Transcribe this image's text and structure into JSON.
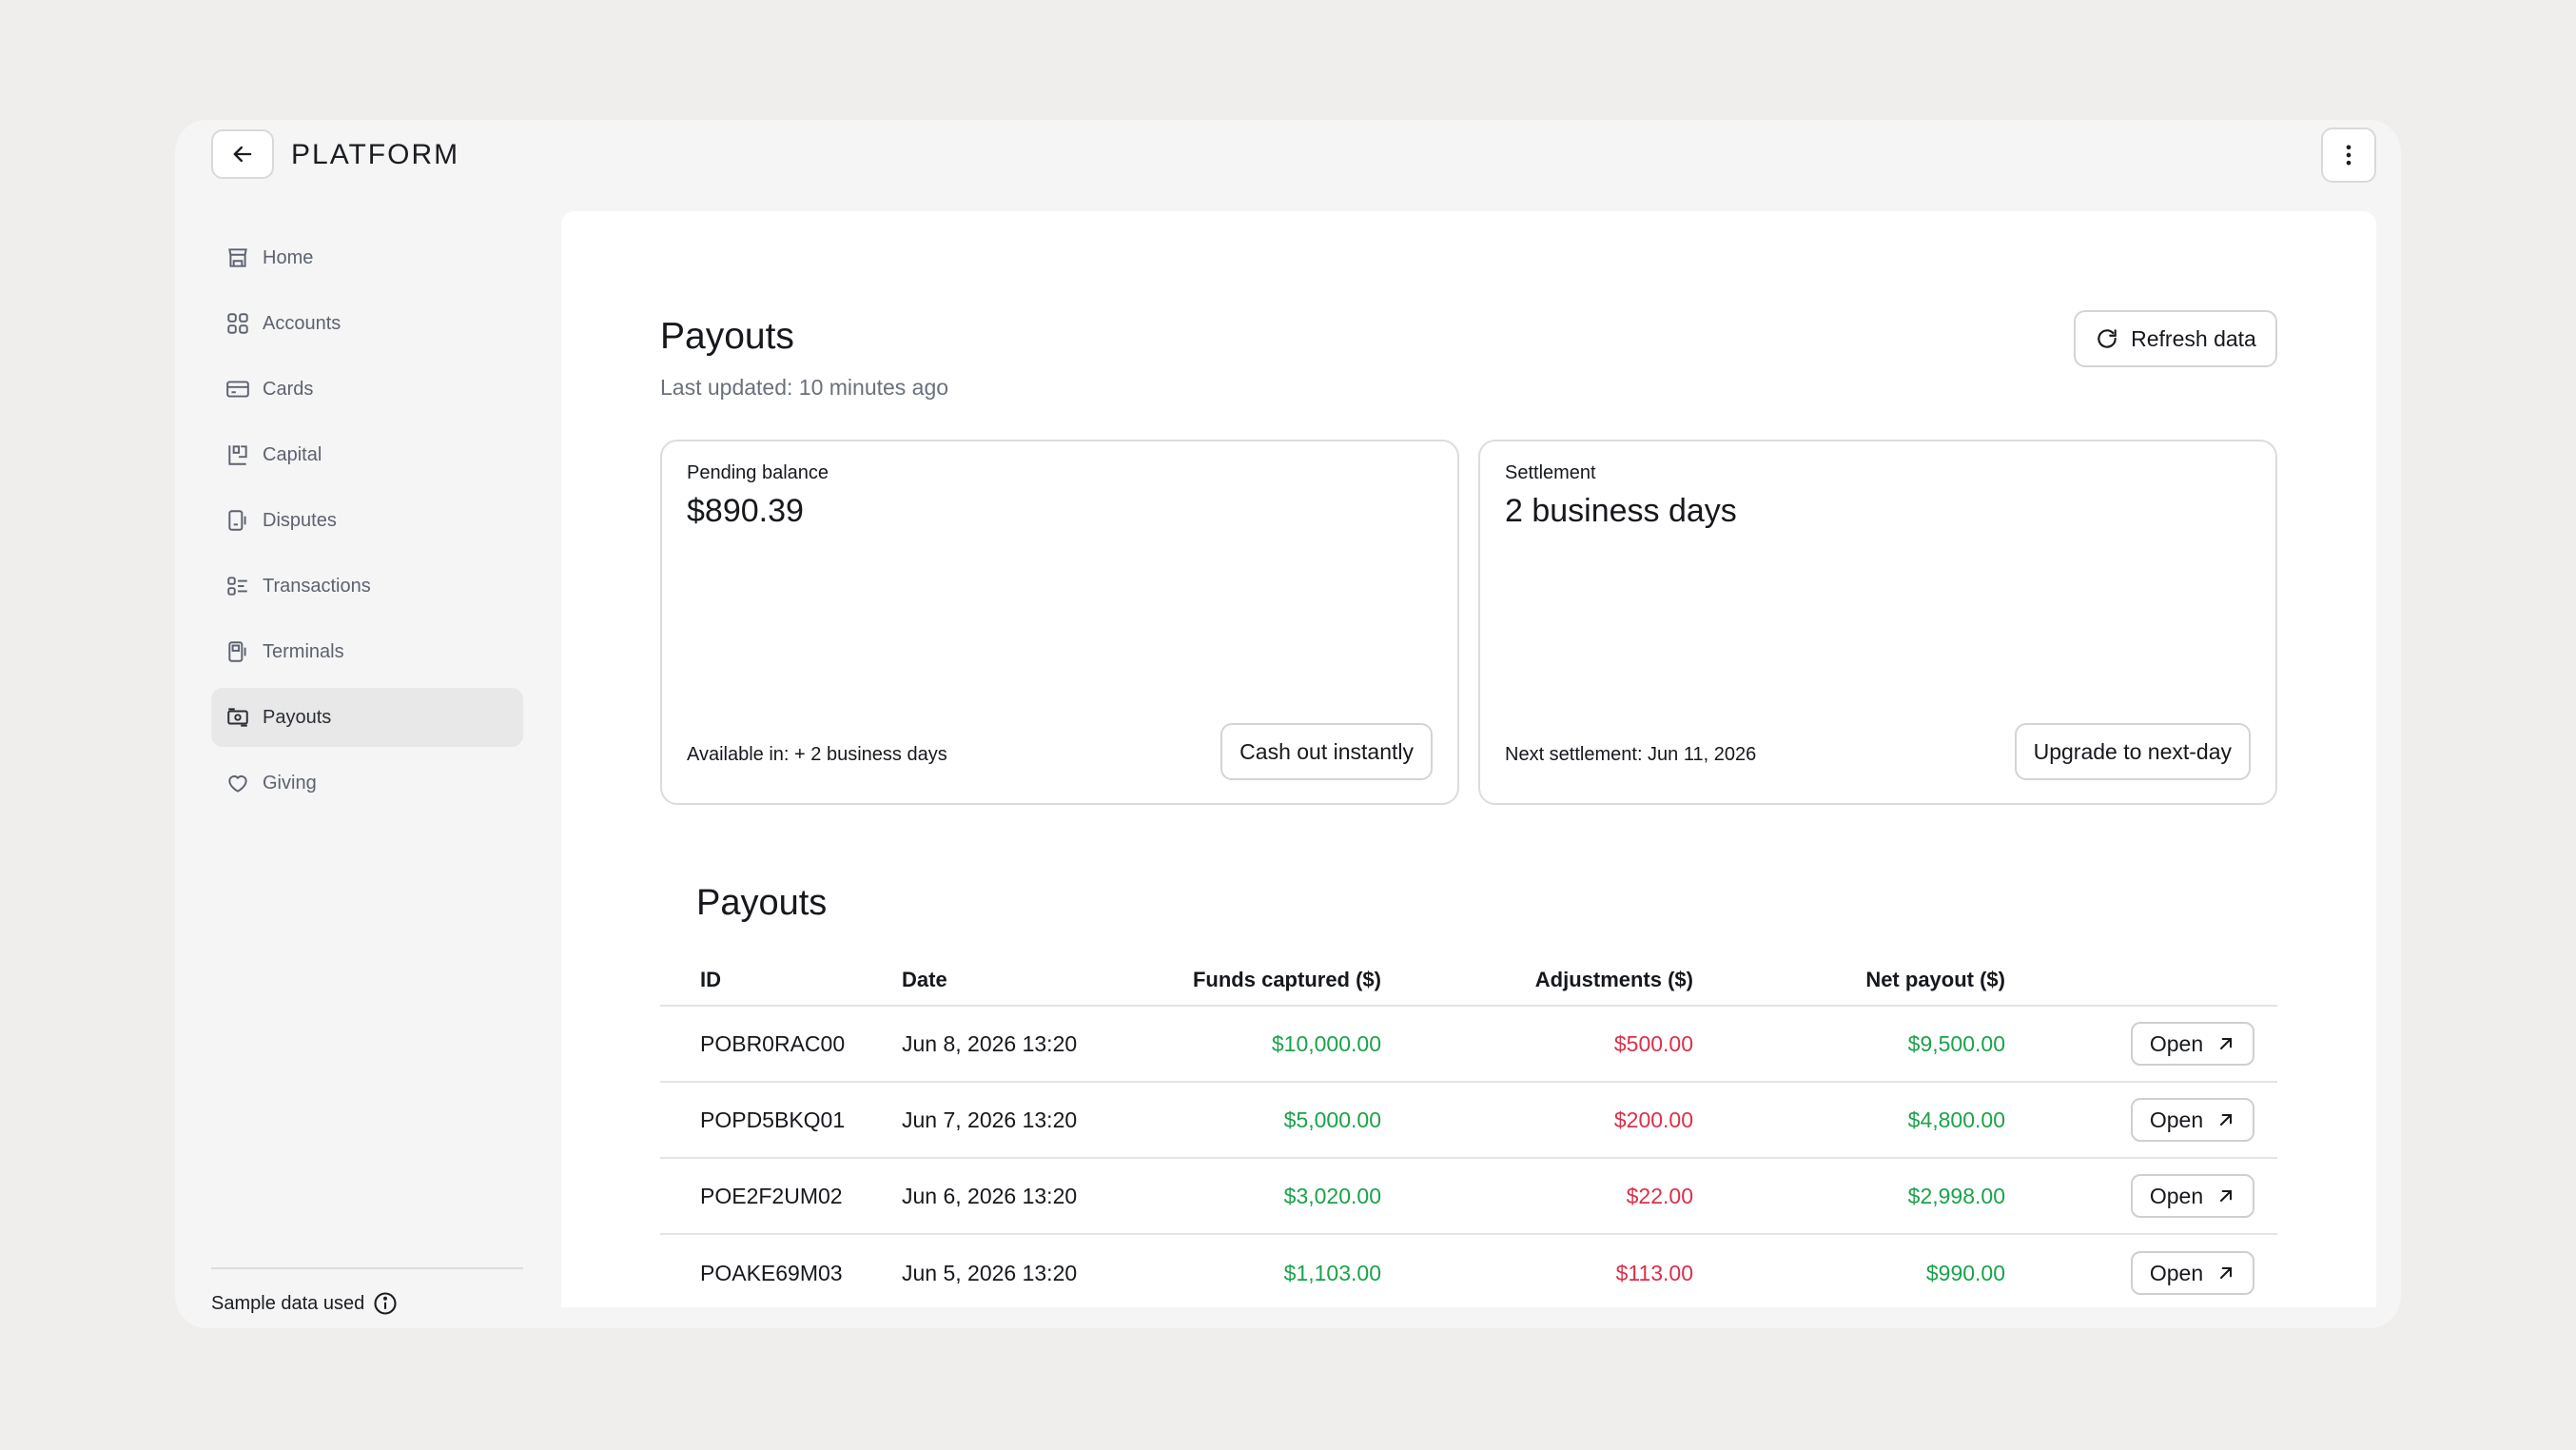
{
  "app": {
    "logo": "PLATFORM"
  },
  "sidebar": {
    "items": [
      {
        "label": "Home",
        "icon": "store-icon"
      },
      {
        "label": "Accounts",
        "icon": "grid-icon"
      },
      {
        "label": "Cards",
        "icon": "card-icon"
      },
      {
        "label": "Capital",
        "icon": "capital-icon"
      },
      {
        "label": "Disputes",
        "icon": "dispute-icon"
      },
      {
        "label": "Transactions",
        "icon": "list-icon"
      },
      {
        "label": "Terminals",
        "icon": "terminal-icon"
      },
      {
        "label": "Payouts",
        "icon": "payout-icon",
        "active": true
      },
      {
        "label": "Giving",
        "icon": "heart-icon"
      }
    ],
    "footer": "Sample data used"
  },
  "header": {
    "title": "Payouts",
    "subtitle": "Last updated: 10 minutes ago",
    "refresh_label": "Refresh data"
  },
  "cards": {
    "pending": {
      "label": "Pending balance",
      "value": "$890.39",
      "foot": "Available in: + 2 business days",
      "button": "Cash out instantly"
    },
    "settlement": {
      "label": "Settlement",
      "value": "2 business days",
      "foot": "Next settlement: Jun 11, 2026",
      "button": "Upgrade to next-day"
    }
  },
  "table": {
    "title": "Payouts",
    "columns": [
      "ID",
      "Date",
      "Funds captured ($)",
      "Adjustments ($)",
      "Net payout ($)"
    ],
    "rows": [
      {
        "id": "POBR0RAC00",
        "date": "Jun 8, 2026 13:20",
        "funds": "$10,000.00",
        "adjustments": "$500.00",
        "net": "$9,500.00",
        "action": "Open"
      },
      {
        "id": "POPD5BKQ01",
        "date": "Jun 7, 2026 13:20",
        "funds": "$5,000.00",
        "adjustments": "$200.00",
        "net": "$4,800.00",
        "action": "Open"
      },
      {
        "id": "POE2F2UM02",
        "date": "Jun 6, 2026 13:20",
        "funds": "$3,020.00",
        "adjustments": "$22.00",
        "net": "$2,998.00",
        "action": "Open"
      },
      {
        "id": "POAKE69M03",
        "date": "Jun 5, 2026 13:20",
        "funds": "$1,103.00",
        "adjustments": "$113.00",
        "net": "$990.00",
        "action": "Open"
      }
    ]
  },
  "colors": {
    "positive": "#1aa34a",
    "negative": "#dc2f4a",
    "background": "#efeeec"
  }
}
